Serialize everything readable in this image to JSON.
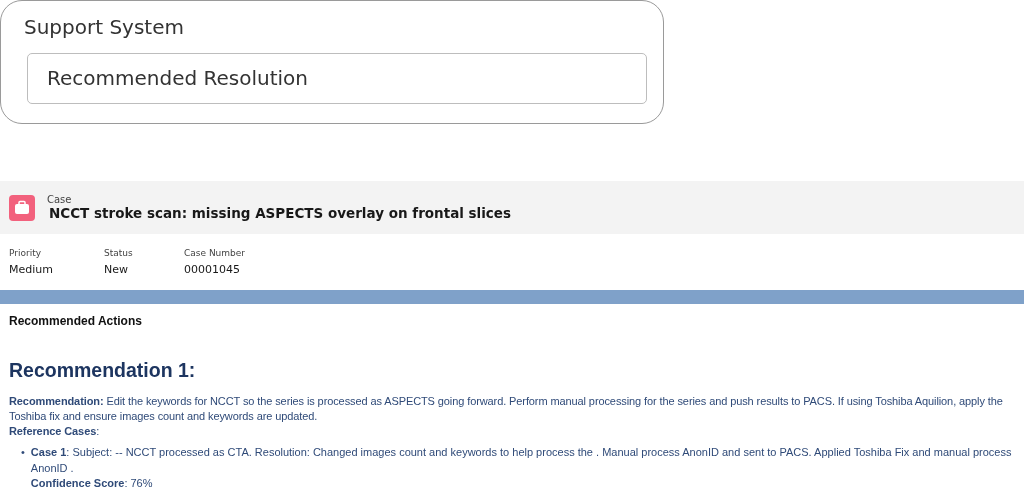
{
  "support_card": {
    "title": "Support System",
    "field_value": "Recommended Resolution"
  },
  "case": {
    "object_label": "Case",
    "subject": "NCCT stroke scan: missing ASPECTS overlay on frontal slices",
    "fields": [
      {
        "label": "Priority",
        "value": "Medium"
      },
      {
        "label": "Status",
        "value": "New"
      },
      {
        "label": "Case Number",
        "value": "00001045"
      }
    ]
  },
  "recommended_actions": {
    "heading": "Recommended Actions",
    "recommendations": [
      {
        "title": "Recommendation 1:",
        "text": "**Recommendation:** Edit the keywords for NCCT so the series is processed as ASPECTS going forward. Perform manual processing for the series and push results to PACS. If using Toshiba Aquilion, apply the Toshiba fix and ensure images count and keywords are updated.",
        "reference_label": "**Reference Cases**:",
        "reference_cases": [
          {
            "bullet": "•",
            "text": "**Case 1**: Subject: -- NCCT processed as CTA. Resolution: Changed images count and keywords to help process the . Manual process AnonID and sent to PACS. Applied Toshiba Fix and manual process AnonID .",
            "confidence": "**Confidence Score**: 76%"
          }
        ]
      }
    ]
  }
}
